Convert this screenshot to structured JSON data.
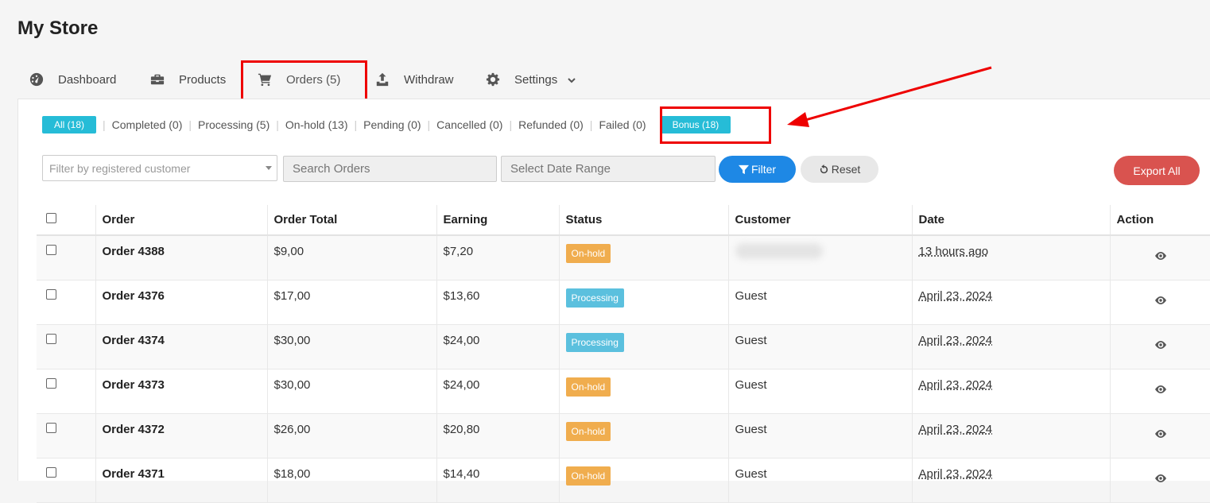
{
  "store": {
    "title": "My Store"
  },
  "nav": {
    "items": [
      {
        "label": "Dashboard",
        "icon": "dashboard-icon"
      },
      {
        "label": "Products",
        "icon": "briefcase-icon"
      },
      {
        "label": "Orders (5)",
        "icon": "cart-icon",
        "active": true
      },
      {
        "label": "Withdraw",
        "icon": "upload-icon"
      },
      {
        "label": "Settings",
        "icon": "gear-icon"
      }
    ]
  },
  "status_filters": [
    {
      "label": "All (18)",
      "active": true
    },
    {
      "label": "Completed (0)"
    },
    {
      "label": "Processing (5)"
    },
    {
      "label": "On-hold (13)"
    },
    {
      "label": "Pending (0)"
    },
    {
      "label": "Cancelled (0)"
    },
    {
      "label": "Refunded (0)"
    },
    {
      "label": "Failed (0)"
    },
    {
      "label": "Bonus (18)",
      "highlighted": true
    }
  ],
  "filters": {
    "customer_placeholder": "Filter by registered customer",
    "search_placeholder": "Search Orders",
    "date_placeholder": "Select Date Range",
    "filter_label": "Filter",
    "reset_label": "Reset",
    "export_label": "Export All"
  },
  "table": {
    "columns": [
      "Order",
      "Order Total",
      "Earning",
      "Status",
      "Customer",
      "Date",
      "Action"
    ],
    "rows": [
      {
        "order": "Order 4388",
        "total": "$9,00",
        "earning": "$7,20",
        "status": "On-hold",
        "customer": "",
        "date": "13 hours ago"
      },
      {
        "order": "Order 4376",
        "total": "$17,00",
        "earning": "$13,60",
        "status": "Processing",
        "customer": "Guest",
        "date": "April 23, 2024"
      },
      {
        "order": "Order 4374",
        "total": "$30,00",
        "earning": "$24,00",
        "status": "Processing",
        "customer": "Guest",
        "date": "April 23, 2024"
      },
      {
        "order": "Order 4373",
        "total": "$30,00",
        "earning": "$24,00",
        "status": "On-hold",
        "customer": "Guest",
        "date": "April 23, 2024"
      },
      {
        "order": "Order 4372",
        "total": "$26,00",
        "earning": "$20,80",
        "status": "On-hold",
        "customer": "Guest",
        "date": "April 23, 2024"
      },
      {
        "order": "Order 4371",
        "total": "$18,00",
        "earning": "$14,40",
        "status": "On-hold",
        "customer": "Guest",
        "date": "April 23, 2024"
      }
    ]
  },
  "colors": {
    "accent": "#26bcd7",
    "filter_button": "#1e88e5",
    "export_button": "#d9534f",
    "onhold": "#f0ad4e",
    "processing": "#5bc0de",
    "annotation": "#e00000"
  }
}
